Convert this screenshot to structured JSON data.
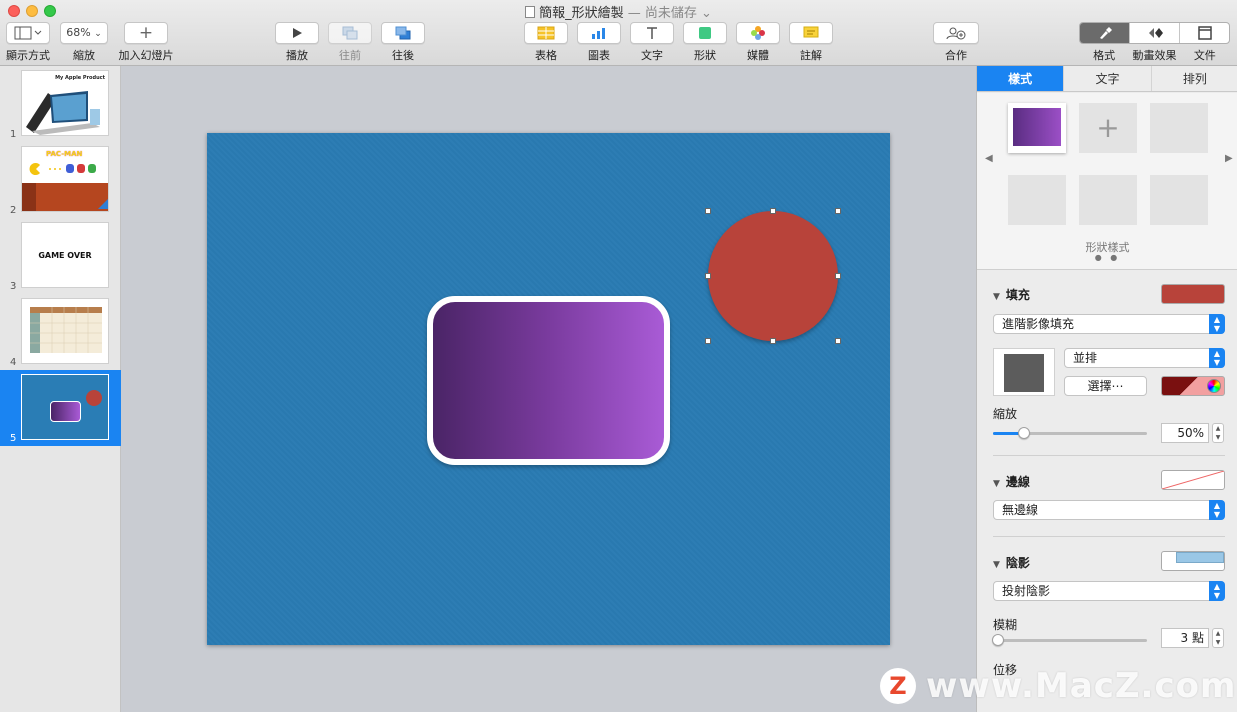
{
  "window": {
    "title": "簡報_形狀繪製",
    "separator": " — ",
    "status": "尚未儲存",
    "status_chevron": "⌄"
  },
  "toolbar": {
    "view": {
      "label": "顯示方式"
    },
    "zoom": {
      "label": "縮放",
      "value": "68%"
    },
    "add_slide": {
      "label": "加入幻燈片"
    },
    "play": {
      "label": "播放"
    },
    "back": {
      "label": "往前"
    },
    "front": {
      "label": "往後"
    },
    "table": {
      "label": "表格"
    },
    "chart": {
      "label": "圖表"
    },
    "text": {
      "label": "文字"
    },
    "shape": {
      "label": "形狀"
    },
    "media": {
      "label": "媒體"
    },
    "comment": {
      "label": "註解"
    },
    "collaborate": {
      "label": "合作"
    },
    "format": {
      "label": "格式"
    },
    "animate": {
      "label": "動畫效果"
    },
    "document": {
      "label": "文件"
    }
  },
  "navigator": {
    "slides": [
      {
        "number": "1",
        "title": "My Apple Product"
      },
      {
        "number": "2",
        "title": "PAC-MAN"
      },
      {
        "number": "3",
        "title": "GAME OVER"
      },
      {
        "number": "4"
      },
      {
        "number": "5",
        "selected": true
      }
    ]
  },
  "canvas": {
    "background_color": "#2a7bb3",
    "rect_gradient": [
      "#4a2466",
      "#a95bd6"
    ],
    "circle_color": "#b8433a"
  },
  "inspector": {
    "tabs": [
      {
        "label": "樣式",
        "active": true
      },
      {
        "label": "文字"
      },
      {
        "label": "排列"
      }
    ],
    "styles_label": "形狀樣式",
    "fill": {
      "header": "填充",
      "color": "#b8433a",
      "type": "進階影像填充",
      "tile_mode": "並排",
      "choose_button": "選擇⋯",
      "scale_label": "縮放",
      "scale_value": "50%",
      "scale_fraction": 0.2
    },
    "border": {
      "header": "邊線",
      "type": "無邊線"
    },
    "shadow": {
      "header": "陰影",
      "type": "投射陰影",
      "blur_label": "模糊",
      "blur_value": "3 點",
      "blur_fraction": 0.03,
      "offset_label": "位移"
    }
  },
  "watermark": {
    "logo": "Z",
    "text": "www.MacZ.com"
  }
}
